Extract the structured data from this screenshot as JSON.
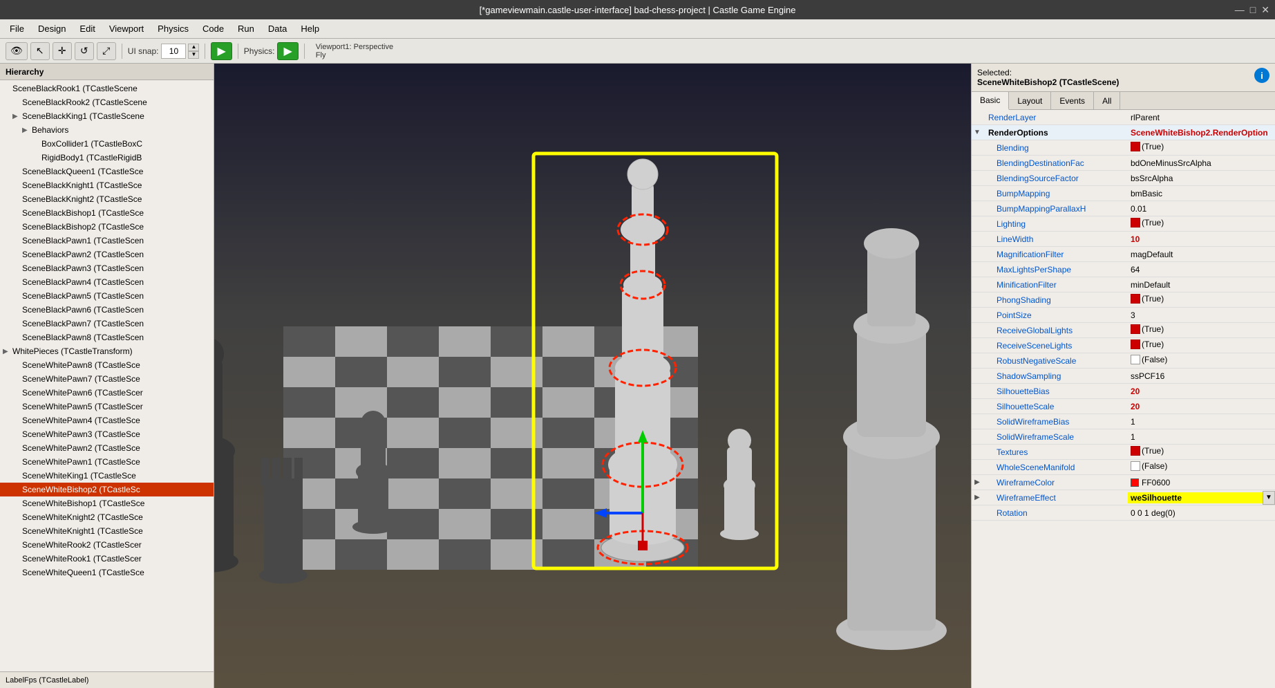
{
  "titlebar": {
    "title": "[*gameviewmain.castle-user-interface] bad-chess-project | Castle Game Engine"
  },
  "window_controls": {
    "minimize": "—",
    "maximize": "□",
    "close": "✕"
  },
  "menu": {
    "items": [
      "File",
      "Design",
      "Edit",
      "Viewport",
      "Physics",
      "Code",
      "Run",
      "Data",
      "Help"
    ]
  },
  "toolbar": {
    "eye_label": "👁",
    "pointer_label": "↖",
    "move_label": "✛",
    "rotate_label": "↺",
    "scale_label": "⤢",
    "ui_snap_label": "UI snap:",
    "snap_value": "10",
    "play_label": "▶",
    "physics_label": "Physics:",
    "physics_play_label": "▶"
  },
  "viewport": {
    "info": "Viewport1: Perspective",
    "mode": "Fly"
  },
  "hierarchy": {
    "title": "Hierarchy",
    "items": [
      {
        "indent": 0,
        "arrow": "",
        "text": "SceneBlackRook1 (TCastleScene",
        "selected": false
      },
      {
        "indent": 1,
        "arrow": "",
        "text": "SceneBlackRook2 (TCastleScene",
        "selected": false
      },
      {
        "indent": 1,
        "arrow": "▶",
        "text": "SceneBlackKing1 (TCastleScene",
        "selected": false
      },
      {
        "indent": 2,
        "arrow": "▶",
        "text": "Behaviors",
        "selected": false
      },
      {
        "indent": 3,
        "arrow": "",
        "text": "BoxCollider1 (TCastleBoxC",
        "selected": false
      },
      {
        "indent": 3,
        "arrow": "",
        "text": "RigidBody1 (TCastleRigidB",
        "selected": false
      },
      {
        "indent": 1,
        "arrow": "",
        "text": "SceneBlackQueen1 (TCastleSce",
        "selected": false
      },
      {
        "indent": 1,
        "arrow": "",
        "text": "SceneBlackKnight1 (TCastleSce",
        "selected": false
      },
      {
        "indent": 1,
        "arrow": "",
        "text": "SceneBlackKnight2 (TCastleSce",
        "selected": false
      },
      {
        "indent": 1,
        "arrow": "",
        "text": "SceneBlackBishop1 (TCastleSce",
        "selected": false
      },
      {
        "indent": 1,
        "arrow": "",
        "text": "SceneBlackBishop2 (TCastleSce",
        "selected": false
      },
      {
        "indent": 1,
        "arrow": "",
        "text": "SceneBlackPawn1 (TCastleScen",
        "selected": false
      },
      {
        "indent": 1,
        "arrow": "",
        "text": "SceneBlackPawn2 (TCastleScen",
        "selected": false
      },
      {
        "indent": 1,
        "arrow": "",
        "text": "SceneBlackPawn3 (TCastleScen",
        "selected": false
      },
      {
        "indent": 1,
        "arrow": "",
        "text": "SceneBlackPawn4 (TCastleScen",
        "selected": false
      },
      {
        "indent": 1,
        "arrow": "",
        "text": "SceneBlackPawn5 (TCastleScen",
        "selected": false
      },
      {
        "indent": 1,
        "arrow": "",
        "text": "SceneBlackPawn6 (TCastleScen",
        "selected": false
      },
      {
        "indent": 1,
        "arrow": "",
        "text": "SceneBlackPawn7 (TCastleScen",
        "selected": false
      },
      {
        "indent": 1,
        "arrow": "",
        "text": "SceneBlackPawn8 (TCastleScen",
        "selected": false
      },
      {
        "indent": 0,
        "arrow": "▶",
        "text": "WhitePieces (TCastleTransform)",
        "selected": false
      },
      {
        "indent": 1,
        "arrow": "",
        "text": "SceneWhitePawn8 (TCastleSce",
        "selected": false
      },
      {
        "indent": 1,
        "arrow": "",
        "text": "SceneWhitePawn7 (TCastleSce",
        "selected": false
      },
      {
        "indent": 1,
        "arrow": "",
        "text": "SceneWhitePawn6 (TCastleScer",
        "selected": false
      },
      {
        "indent": 1,
        "arrow": "",
        "text": "SceneWhitePawn5 (TCastleScer",
        "selected": false
      },
      {
        "indent": 1,
        "arrow": "",
        "text": "SceneWhitePawn4 (TCastleSce",
        "selected": false
      },
      {
        "indent": 1,
        "arrow": "",
        "text": "SceneWhitePawn3 (TCastleSce",
        "selected": false
      },
      {
        "indent": 1,
        "arrow": "",
        "text": "SceneWhitePawn2 (TCastleSce",
        "selected": false
      },
      {
        "indent": 1,
        "arrow": "",
        "text": "SceneWhitePawn1 (TCastleSce",
        "selected": false
      },
      {
        "indent": 1,
        "arrow": "",
        "text": "SceneWhiteKing1 (TCastleSce",
        "selected": false
      },
      {
        "indent": 1,
        "arrow": "",
        "text": "SceneWhiteBishop2 (TCastleSc",
        "selected": true
      },
      {
        "indent": 1,
        "arrow": "",
        "text": "SceneWhiteBishop1 (TCastleSce",
        "selected": false
      },
      {
        "indent": 1,
        "arrow": "",
        "text": "SceneWhiteKnight2 (TCastleSce",
        "selected": false
      },
      {
        "indent": 1,
        "arrow": "",
        "text": "SceneWhiteKnight1 (TCastleSce",
        "selected": false
      },
      {
        "indent": 1,
        "arrow": "",
        "text": "SceneWhiteRook2 (TCastleScer",
        "selected": false
      },
      {
        "indent": 1,
        "arrow": "",
        "text": "SceneWhiteRook1 (TCastleScer",
        "selected": false
      },
      {
        "indent": 1,
        "arrow": "",
        "text": "SceneWhiteQueen1 (TCastleSce",
        "selected": false
      }
    ],
    "bottom_text": "LabelFps (TCastleLabel)"
  },
  "selected_info": {
    "label": "Selected:",
    "name": "SceneWhiteBishop2 (TCastleScene)"
  },
  "prop_tabs": [
    "Basic",
    "Layout",
    "Events",
    "All"
  ],
  "prop_active_tab": "Basic",
  "properties": {
    "render_layer_label": "RenderLayer",
    "render_layer_value": "rlParent",
    "render_options_label": "RenderOptions",
    "render_options_value": "SceneWhiteBishop2.RenderOption",
    "items": [
      {
        "expander": "",
        "name": "Blending",
        "value_type": "checkbox_true",
        "value": "(True)"
      },
      {
        "expander": "",
        "name": "BlendingDestinationFac",
        "value_type": "text",
        "value": "bdOneMinusSrcAlpha"
      },
      {
        "expander": "",
        "name": "BlendingSourceFactor",
        "value_type": "text",
        "value": "bsSrcAlpha"
      },
      {
        "expander": "",
        "name": "BumpMapping",
        "value_type": "text",
        "value": "bmBasic"
      },
      {
        "expander": "",
        "name": "BumpMappingParallaxH",
        "value_type": "text",
        "value": "0.01"
      },
      {
        "expander": "",
        "name": "Lighting",
        "value_type": "checkbox_true",
        "value": "(True)"
      },
      {
        "expander": "",
        "name": "LineWidth",
        "value_type": "bold",
        "value": "10"
      },
      {
        "expander": "",
        "name": "MagnificationFilter",
        "value_type": "text",
        "value": "magDefault"
      },
      {
        "expander": "",
        "name": "MaxLightsPerShape",
        "value_type": "text",
        "value": "64"
      },
      {
        "expander": "",
        "name": "MinificationFilter",
        "value_type": "text",
        "value": "minDefault"
      },
      {
        "expander": "",
        "name": "PhongShading",
        "value_type": "checkbox_true",
        "value": "(True)"
      },
      {
        "expander": "",
        "name": "PointSize",
        "value_type": "text",
        "value": "3"
      },
      {
        "expander": "",
        "name": "ReceiveGlobalLights",
        "value_type": "checkbox_true",
        "value": "(True)"
      },
      {
        "expander": "",
        "name": "ReceiveSceneLights",
        "value_type": "checkbox_true",
        "value": "(True)"
      },
      {
        "expander": "",
        "name": "RobustNegativeScale",
        "value_type": "checkbox_false",
        "value": "(False)"
      },
      {
        "expander": "",
        "name": "ShadowSampling",
        "value_type": "text",
        "value": "ssPCF16"
      },
      {
        "expander": "",
        "name": "SilhouetteBias",
        "value_type": "bold",
        "value": "20"
      },
      {
        "expander": "",
        "name": "SilhouetteScale",
        "value_type": "bold",
        "value": "20"
      },
      {
        "expander": "",
        "name": "SolidWireframeBias",
        "value_type": "text",
        "value": "1"
      },
      {
        "expander": "",
        "name": "SolidWireframeScale",
        "value_type": "text",
        "value": "1"
      },
      {
        "expander": "",
        "name": "Textures",
        "value_type": "checkbox_true",
        "value": "(True)"
      },
      {
        "expander": "",
        "name": "WholeSceneManifold",
        "value_type": "checkbox_false",
        "value": "(False)"
      },
      {
        "expander": "▶",
        "name": "WireframeColor",
        "value_type": "color",
        "value": "FF0600"
      },
      {
        "expander": "▶",
        "name": "WireframeEffect",
        "value_type": "dropdown",
        "value": "weSilhouette"
      },
      {
        "expander": "",
        "name": "Rotation",
        "value_type": "text",
        "value": "0 0 1 deg(0)"
      }
    ]
  }
}
